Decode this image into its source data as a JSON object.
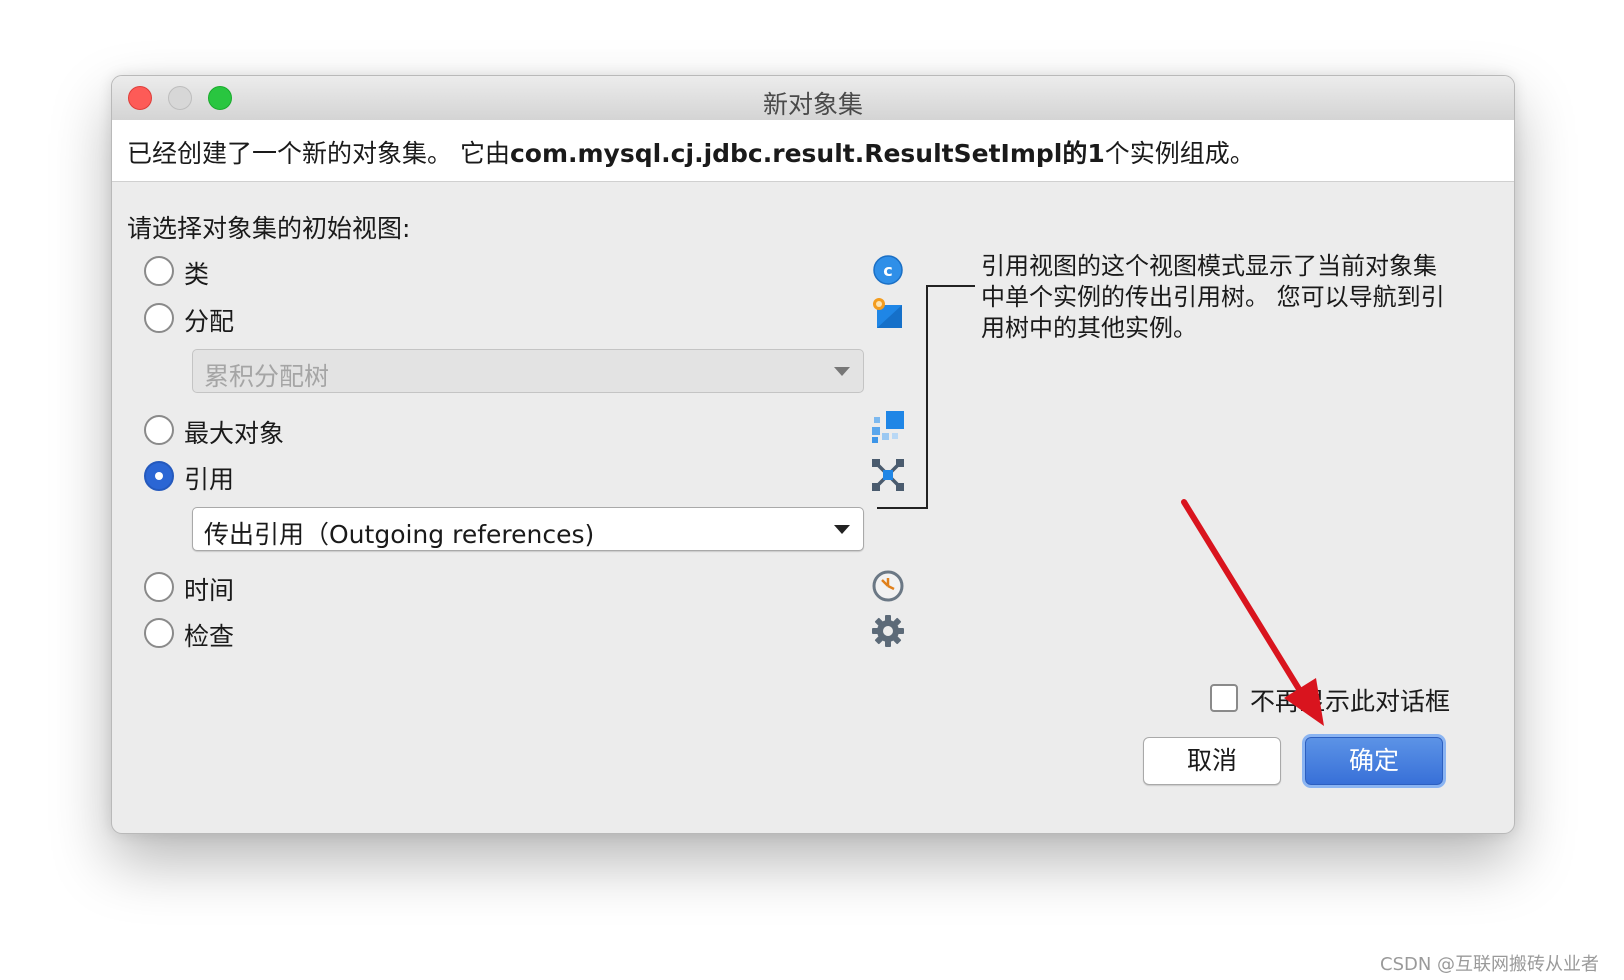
{
  "window": {
    "title": "新对象集",
    "colors": {
      "close": "#fd5b57",
      "minimize": "#d7d7d7",
      "maximize": "#29c640"
    }
  },
  "info": {
    "prefix": "已经创建了一个新的对象集。 它由",
    "class_name": "com.mysql.cj.jdbc.result.ResultSetImpl",
    "middle": "的",
    "count": "1",
    "suffix": "个实例组成。"
  },
  "prompt": "请选择对象集的初始视图:",
  "options": [
    {
      "label": "类",
      "icon": "class-c-icon",
      "checked": false
    },
    {
      "label": "分配",
      "icon": "allocation-icon",
      "checked": false
    },
    {
      "label": "最大对象",
      "icon": "biggest-objects-icon",
      "checked": false
    },
    {
      "label": "引用",
      "icon": "references-icon",
      "checked": true
    },
    {
      "label": "时间",
      "icon": "clock-icon",
      "checked": false
    },
    {
      "label": "检查",
      "icon": "gear-icon",
      "checked": false
    }
  ],
  "allocation_select": {
    "value": "累积分配树",
    "enabled": false
  },
  "reference_select": {
    "value": "传出引用（Outgoing references)",
    "enabled": true
  },
  "description": "引用视图的这个视图模式显示了当前对象集中单个实例的传出引用树。 您可以导航到引用树中的其他实例。",
  "dont_show_again": {
    "label": "不再显示此对话框",
    "checked": false
  },
  "buttons": {
    "cancel": "取消",
    "ok": "确定"
  },
  "accent_color": "#3870d8",
  "annotation_arrow_color": "#d9141e",
  "watermark": "CSDN @互联网搬砖从业者"
}
